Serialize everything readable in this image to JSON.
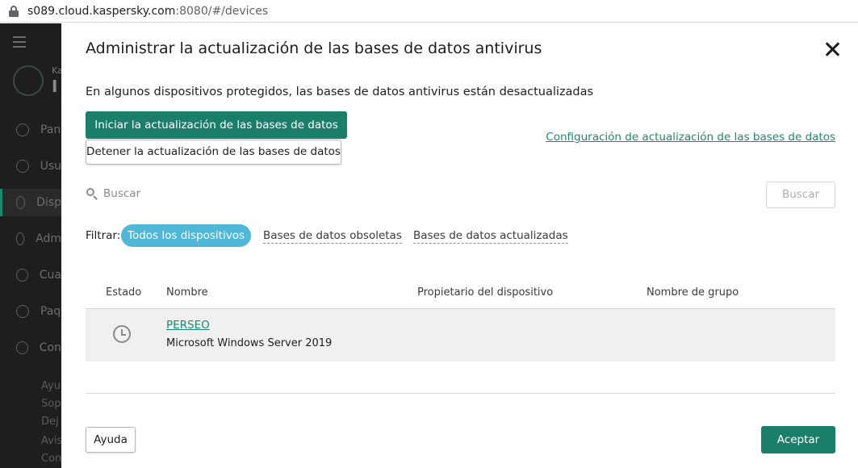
{
  "browser": {
    "url_host": "s089.cloud.kaspersky.com",
    "url_path": ":8080/#/devices"
  },
  "sidebar": {
    "logo_text_small": "Ka",
    "logo_text_large": "I",
    "items": [
      {
        "label": "Pan",
        "icon": "info-icon"
      },
      {
        "label": "Usu",
        "icon": "user-icon"
      },
      {
        "label": "Disp",
        "icon": "devices-icon",
        "active": true
      },
      {
        "label": "Adm",
        "icon": "admins-icon"
      },
      {
        "label": "Cua",
        "icon": "quarantine-icon"
      },
      {
        "label": "Paq",
        "icon": "packages-icon"
      },
      {
        "label": "Con",
        "icon": "settings-icon"
      }
    ],
    "footer": [
      "Ayu",
      "Sop",
      "Dej",
      "Avis",
      "Con"
    ]
  },
  "modal": {
    "title": "Administrar la actualización de las bases de datos antivirus",
    "subtitle": "En algunos dispositivos protegidos, las bases de datos antivirus están desactualizadas",
    "start_update_label": "Iniciar la actualización de las bases de datos",
    "stop_update_label": "Detener la actualización de las bases de datos",
    "config_link": "Configuración de actualización de las bases de datos",
    "search": {
      "placeholder": "Buscar",
      "value": "",
      "button_label": "Buscar"
    },
    "filter": {
      "label": "Filtrar:",
      "options": [
        "Todos los dispositivos",
        "Bases de datos obsoletas",
        "Bases de datos actualizadas"
      ],
      "selected": "Todos los dispositivos"
    },
    "table": {
      "columns": [
        "Estado",
        "Nombre",
        "Propietario del dispositivo",
        "Nombre de grupo"
      ],
      "rows": [
        {
          "status_icon": "clock-icon",
          "name": "PERSEO",
          "os": "Microsoft Windows Server 2019",
          "owner": "",
          "group": ""
        }
      ]
    },
    "help_label": "Ayuda",
    "accept_label": "Aceptar"
  },
  "colors": {
    "primary": "#1a7f68",
    "link": "#1a8a6f",
    "chip_active": "#4fb7d8",
    "sidebar_bg": "#1e1e1e"
  }
}
